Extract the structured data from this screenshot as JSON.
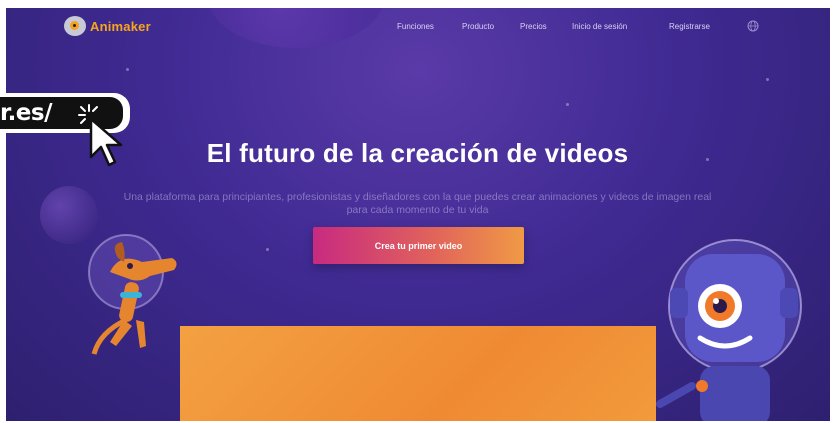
{
  "brand": {
    "name": "Animaker",
    "accent": "#f7a51c"
  },
  "nav": {
    "links": [
      "Funciones",
      "Producto",
      "Precios",
      "Inicio de sesión",
      "Registrarse"
    ],
    "globe_icon": "globe-icon"
  },
  "overlay": {
    "url_fragment": "r.es/",
    "cursor_icon": "click-cursor-icon"
  },
  "hero": {
    "title": "El futuro de la creación de videos",
    "subtitle": "Una plataforma para principiantes, profesionistas y diseñadores con la que puedes crear animaciones y videos de imagen real para cada momento de tu vida",
    "cta_label": "Crea tu primer video"
  },
  "colors": {
    "background": "#3f2a92",
    "cta_start": "#c82a80",
    "cta_end": "#f09a45",
    "panel": "#f3a142"
  }
}
